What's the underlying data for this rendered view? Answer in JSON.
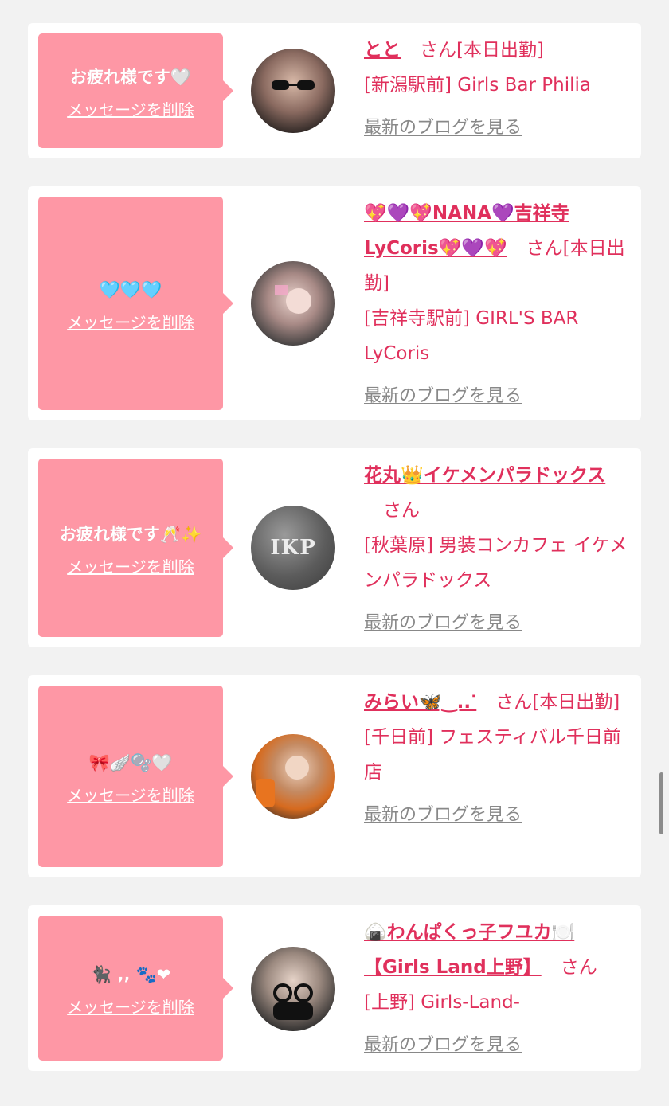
{
  "delete_label": "メッセージを削除",
  "blog_label": "最新のブログを見る",
  "san_label": "さん",
  "colors": {
    "bubble": "#fe97a5",
    "accent": "#e0305c",
    "blog_link": "#888888",
    "card": "#ffffff",
    "page_bg": "#f2f2f2"
  },
  "cards": [
    {
      "message": "お疲れ様です🤍",
      "name": "とと",
      "status": "[本日出勤]",
      "shop": "[新潟駅前] Girls Bar Philia",
      "avatar_icon": "avatar-photo"
    },
    {
      "message": "🩵🩵🩵",
      "name": "💖💜💖NANA💜吉祥寺LyCoris💖💜💖",
      "status": "[本日出勤]",
      "shop": "[吉祥寺駅前] GIRL'S BAR LyCoris",
      "avatar_icon": "avatar-photo"
    },
    {
      "message": "お疲れ様です🥂✨",
      "name": "花丸👑イケメンパラドックス",
      "status": "",
      "shop": "[秋葉原] 男装コンカフェ イケメンパラドックス",
      "avatar_icon": "ikp-logo",
      "avatar_text": "IKP"
    },
    {
      "message": "🎀🪽🫧🤍",
      "name": "みらい🦋‿..ᐝ",
      "status": "[本日出勤]",
      "shop": "[千日前] フェスティバル千日前店",
      "avatar_icon": "avatar-photo"
    },
    {
      "message": "🐈‍⬛ ‚‚ 🐾❤",
      "name": "🍙わんぱくっ子フユカ🍽️【Girls Land上野】",
      "status": "",
      "shop": "[上野] Girls-Land-",
      "avatar_icon": "avatar-photo"
    }
  ]
}
